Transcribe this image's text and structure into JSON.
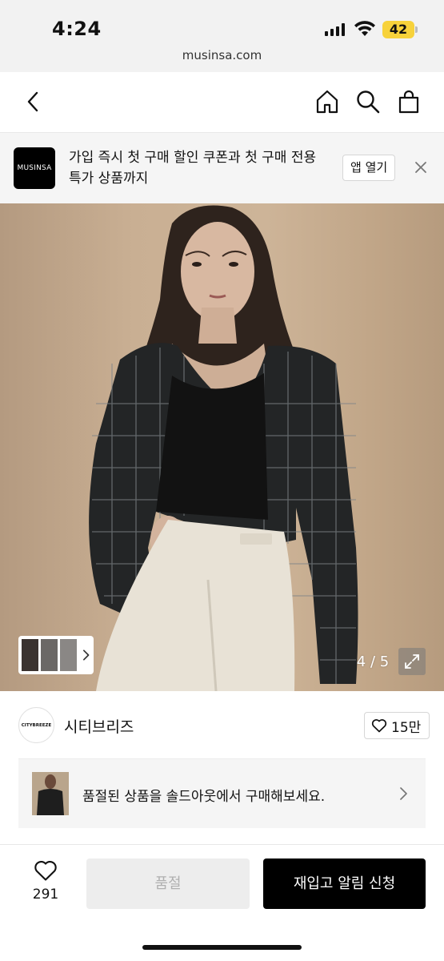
{
  "status_bar": {
    "time": "4:24",
    "url": "musinsa.com",
    "battery": "42",
    "battery_color": "#f7d23b"
  },
  "nav": {
    "icons": [
      "chevron-left-icon",
      "home-icon",
      "search-icon",
      "shopping-bag-icon"
    ]
  },
  "promo": {
    "logo_text": "MUSINSA",
    "message": "가입 즉시 첫 구매 할인 쿠폰과 첫 구매 전용 특가 상품까지",
    "open_app_label": "앱 열기"
  },
  "gallery": {
    "counter": "4 / 5",
    "progress": {
      "current": 4,
      "total": 5
    }
  },
  "brand": {
    "logo_text": "CITYBREEZE",
    "name": "시티브리즈",
    "likes": "15만"
  },
  "soldout_banner": {
    "message": "품절된 상품을 솔드아웃에서 구매해보세요."
  },
  "bottom_bar": {
    "wish_count": "291",
    "soldout_label": "품절",
    "restock_label": "재입고 알림 신청"
  },
  "colors": {
    "accent": "#000000",
    "disabled_bg": "#ededed",
    "disabled_text": "#b0b0b0"
  }
}
